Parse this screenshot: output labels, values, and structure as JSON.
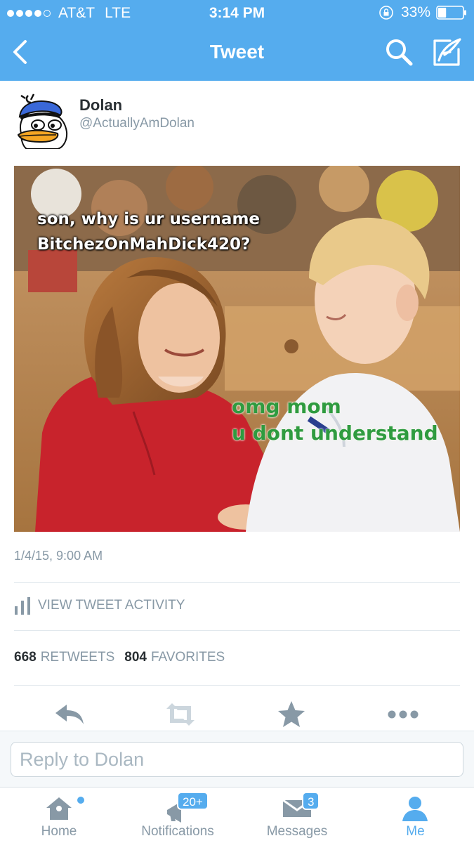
{
  "status_bar": {
    "carrier": "AT&T",
    "network": "LTE",
    "time": "3:14 PM",
    "battery": "33%",
    "signal_bars": 4,
    "signal_total": 5,
    "battery_level": 0.33
  },
  "nav": {
    "title": "Tweet",
    "icons": [
      "chevron-left-icon",
      "search-icon",
      "compose-icon"
    ]
  },
  "tweet": {
    "author_name": "Dolan",
    "author_handle": "@ActuallyAmDolan",
    "image_text_top": [
      "son, why is ur username",
      "BitchezOnMahDick420?"
    ],
    "image_text_bottom": [
      "omg mom",
      "u dont understand"
    ],
    "timestamp": "1/4/15, 9:00 AM",
    "activity_label": "VIEW TWEET ACTIVITY",
    "retweets_count": "668",
    "retweets_label": "RETWEETS",
    "favorites_count": "804",
    "favorites_label": "FAVORITES",
    "actions": [
      "reply-icon",
      "retweet-icon",
      "favorite-star-icon",
      "more-icon"
    ]
  },
  "reply": {
    "placeholder": "Reply to Dolan"
  },
  "tabs": [
    {
      "label": "Home",
      "icon": "home-icon",
      "new_indicator": true
    },
    {
      "label": "Notifications",
      "icon": "notifications-icon",
      "badge": "20+"
    },
    {
      "label": "Messages",
      "icon": "messages-icon",
      "badge": "3"
    },
    {
      "label": "Me",
      "icon": "profile-icon",
      "active": true
    }
  ],
  "colors": {
    "brand": "#55acee",
    "text_primary": "#292f33",
    "text_secondary": "#8899a6",
    "divider": "#e1e8ed",
    "icon_gray": "#8899a6"
  }
}
